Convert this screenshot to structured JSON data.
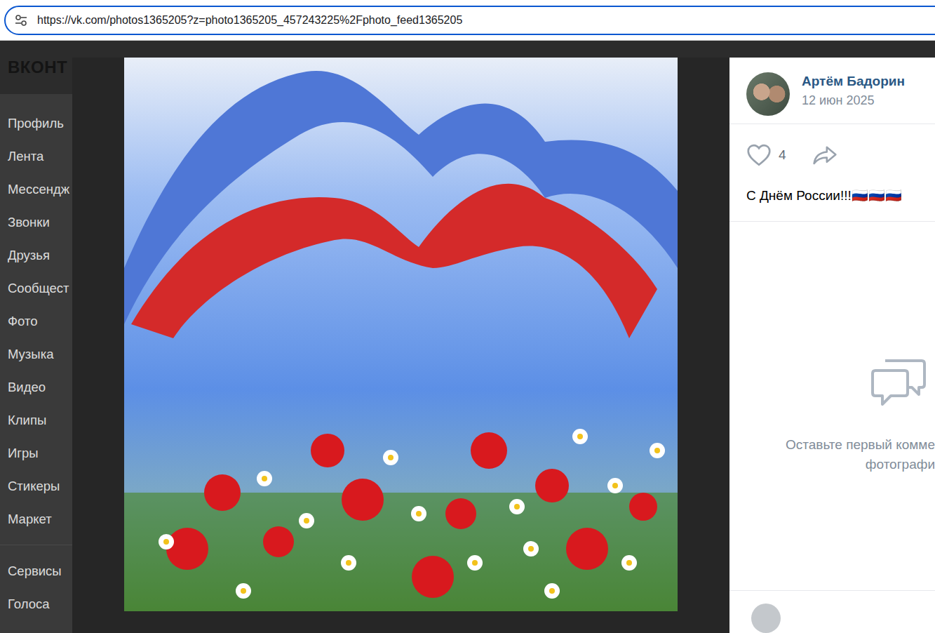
{
  "browser": {
    "url": "https://vk.com/photos1365205?z=photo1365205_457243225%2Fphoto_feed1365205"
  },
  "sidebar": {
    "logo": "ВКОНТ",
    "items": [
      "Профиль",
      "Лента",
      "Мессендж",
      "Звонки",
      "Друзья",
      "Сообщест",
      "Фото",
      "Музыка",
      "Видео",
      "Клипы",
      "Игры",
      "Стикеры",
      "Маркет"
    ],
    "secondary_items": [
      "Сервисы",
      "Голоса"
    ]
  },
  "viewer": {
    "author": {
      "name": "Артём Бадорин",
      "date": "12 июн 2025"
    },
    "likes": "4",
    "liked": false,
    "caption": "С Днём России!!!🇷🇺🇷🇺🇷🇺",
    "comments_empty": [
      "Оставьте первый комме",
      "фотографи"
    ]
  }
}
